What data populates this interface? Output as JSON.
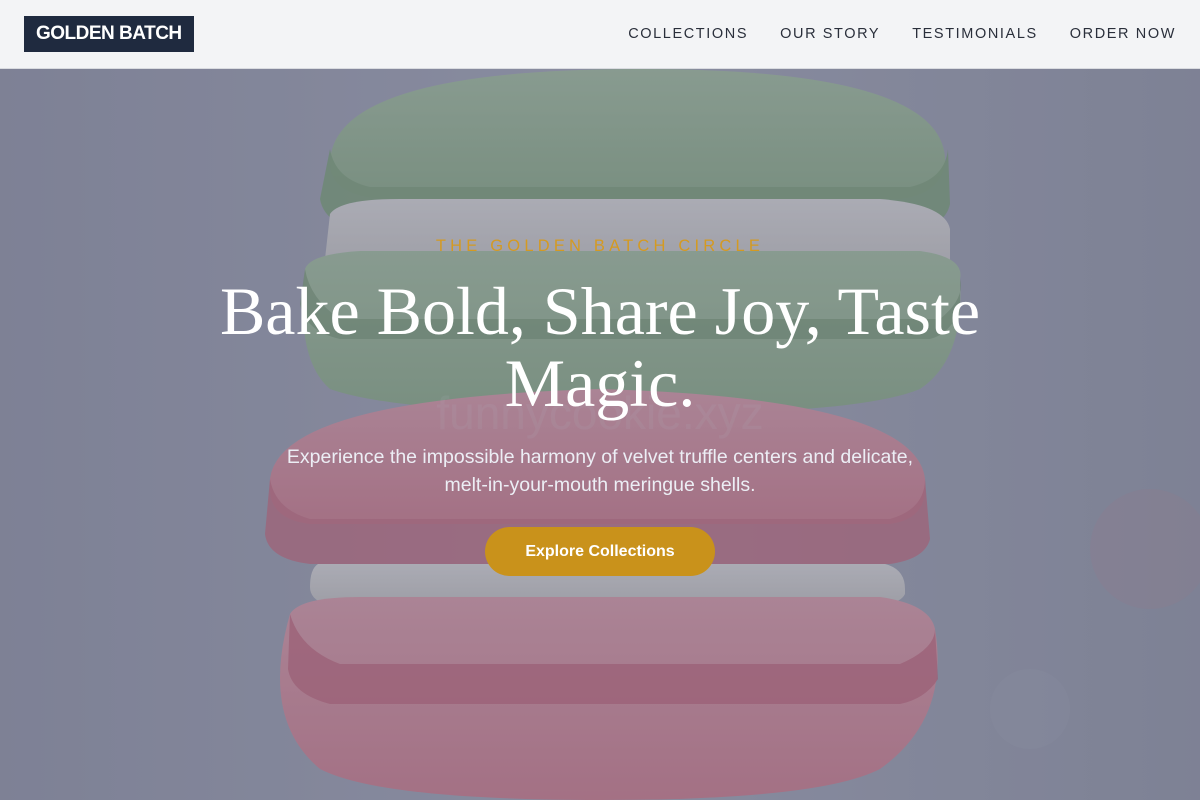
{
  "brand": {
    "logo_text": "GOLDEN BATCH"
  },
  "nav": {
    "items": [
      {
        "label": "COLLECTIONS"
      },
      {
        "label": "OUR STORY"
      },
      {
        "label": "TESTIMONIALS"
      },
      {
        "label": "ORDER NOW"
      }
    ]
  },
  "hero": {
    "eyebrow": "THE GOLDEN BATCH CIRCLE",
    "headline": "Bake Bold, Share Joy, Taste Magic.",
    "subtext": "Experience the impossible harmony of velvet truffle centers and delicate, melt-in-your-mouth meringue shells.",
    "cta_label": "Explore Collections",
    "background_image": "macaron-stack-photo",
    "watermark": "funnycookie.xyz"
  },
  "colors": {
    "logo_bg": "#1f2a3f",
    "accent_gold": "#c9921b",
    "eyebrow_gold": "#d49a22",
    "header_bg": "#f3f4f6",
    "nav_text": "#2a2f3b"
  }
}
